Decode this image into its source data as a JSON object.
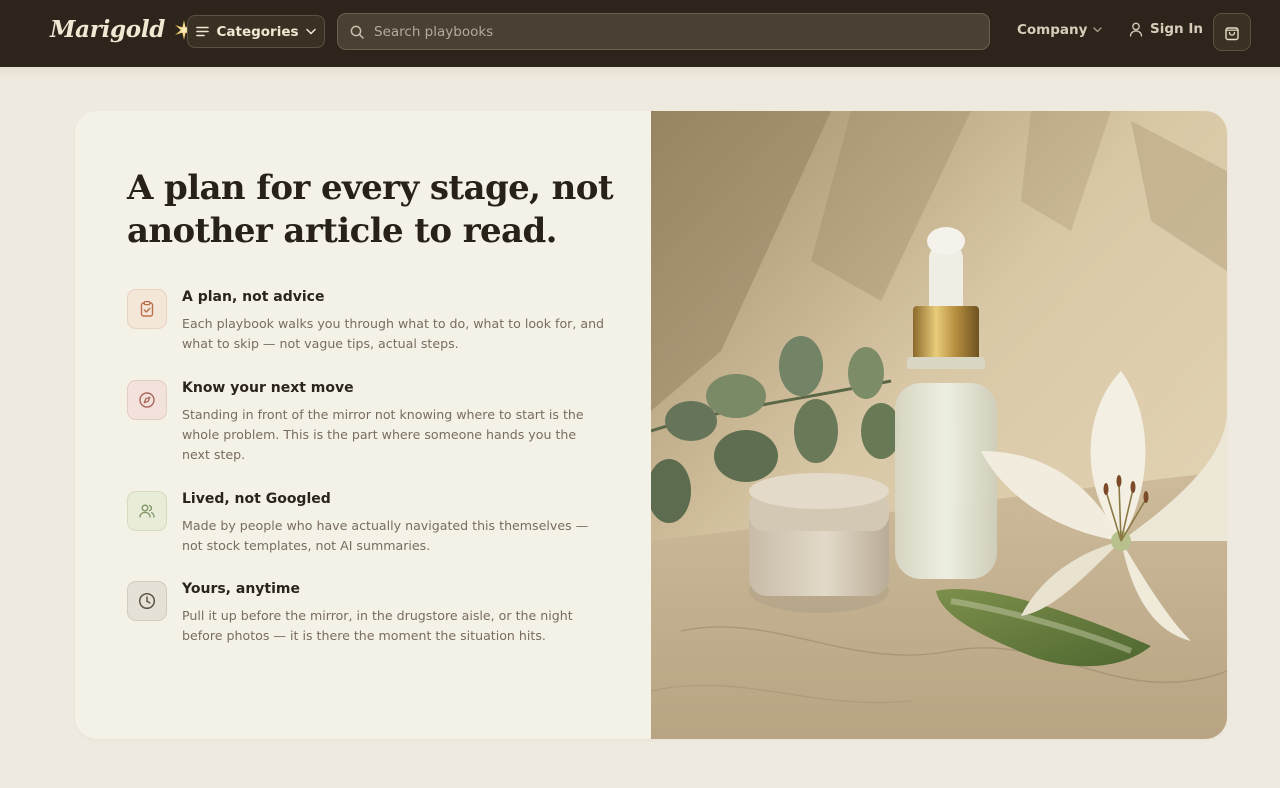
{
  "header": {
    "logo": "Marigold",
    "categories_label": "Categories",
    "search_placeholder": "Search playbooks",
    "company_label": "Company",
    "signin_label": "Sign In"
  },
  "hero": {
    "headline_line1": "A plan for every stage, not",
    "headline_line2": "another article to read."
  },
  "features": [
    {
      "icon": "clipboard-check-icon",
      "title": "A plan, not advice",
      "desc": "Each playbook walks you through what to do, what to look for, and what to skip — not vague tips, actual steps."
    },
    {
      "icon": "compass-icon",
      "title": "Know your next move",
      "desc": "Standing in front of the mirror not knowing where to start is the whole problem. This is the part where someone hands you the next step."
    },
    {
      "icon": "users-icon",
      "title": "Lived, not Googled",
      "desc": "Made by people who have actually navigated this themselves — not stock templates, not AI summaries."
    },
    {
      "icon": "clock-icon",
      "title": "Yours, anytime",
      "desc": "Pull it up before the mirror, in the drugstore aisle, or the night before photos — it is there the moment the situation hits."
    }
  ],
  "colors": {
    "nav_bg": "#2d251b",
    "page_bg": "#efeadf",
    "card_bg": "#f4f1e6",
    "accent_gold": "#e9c25a"
  }
}
